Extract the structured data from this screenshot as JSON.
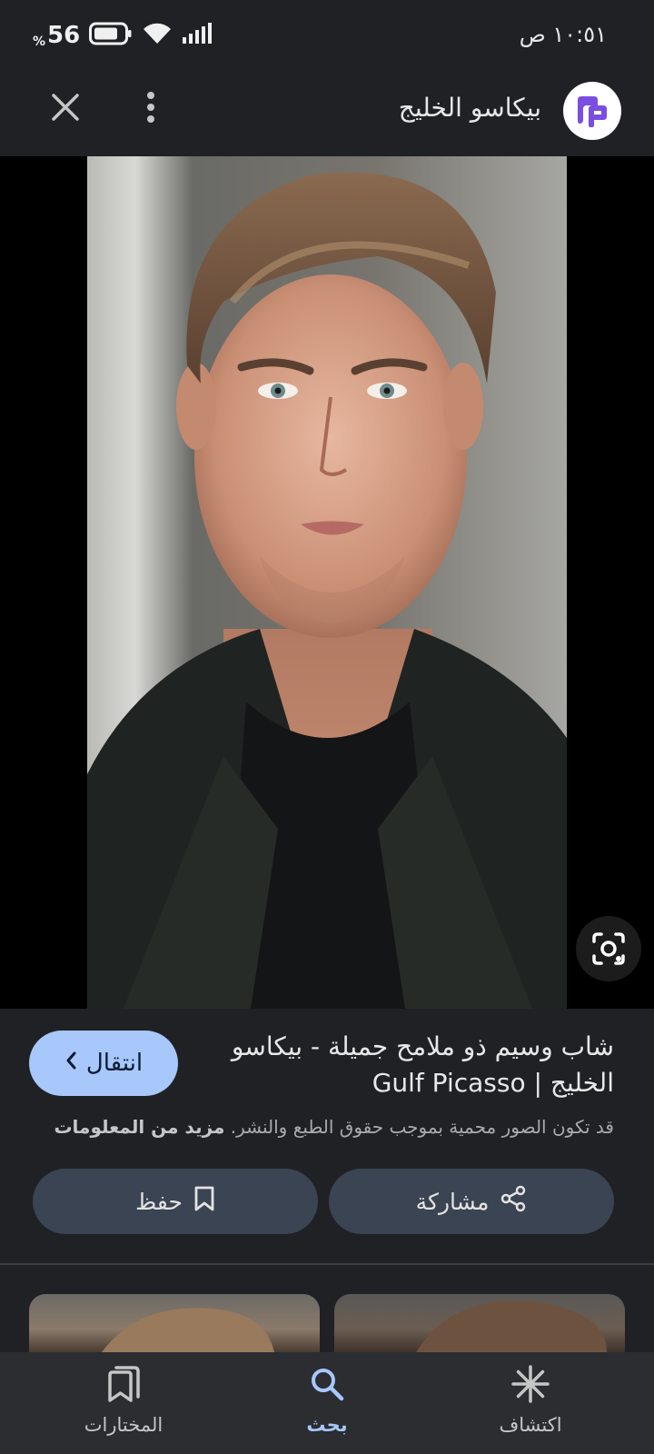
{
  "status_bar": {
    "time": "١٠:٥١ ص",
    "battery_percent": "56",
    "battery_percent_sign": "%"
  },
  "header": {
    "site_name": "بيكاسو الخليج",
    "logo_icon": "gulf-picasso-logo",
    "more_icon": "more-vert-icon",
    "close_icon": "close-icon"
  },
  "viewer": {
    "lens_icon": "lens-search-icon"
  },
  "info": {
    "title": "شاب وسيم ذو ملامح جميلة - بيكاسو الخليج | Gulf Picasso",
    "visit_label": "انتقال",
    "copyright_text": "قد تكون الصور محمية بموجب حقوق الطبع والنشر.",
    "learn_more": "مزيد من المعلومات",
    "share_label": "مشاركة",
    "save_label": "حفظ"
  },
  "bottom_nav": {
    "items": [
      {
        "label": "اكتشاف",
        "icon": "asterisk-icon",
        "active": false
      },
      {
        "label": "بحث",
        "icon": "search-icon",
        "active": true
      },
      {
        "label": "المختارات",
        "icon": "collections-icon",
        "active": false
      }
    ]
  },
  "colors": {
    "accent": "#a8c7fa",
    "background": "#1f2125",
    "button_bg": "#3a4452",
    "nav_bg": "#2b2d31"
  }
}
